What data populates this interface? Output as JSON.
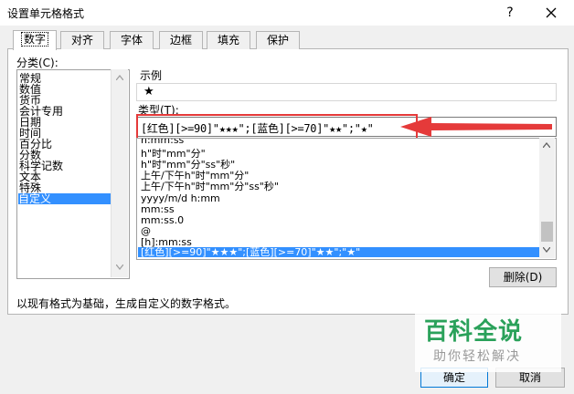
{
  "window": {
    "title": "设置单元格格式",
    "help": "?"
  },
  "tabs": [
    {
      "label": "数字",
      "active": true
    },
    {
      "label": "对齐",
      "active": false
    },
    {
      "label": "字体",
      "active": false
    },
    {
      "label": "边框",
      "active": false
    },
    {
      "label": "填充",
      "active": false
    },
    {
      "label": "保护",
      "active": false
    }
  ],
  "category": {
    "label": "分类(C):",
    "items": [
      "常规",
      "数值",
      "货币",
      "会计专用",
      "日期",
      "时间",
      "百分比",
      "分数",
      "科学记数",
      "文本",
      "特殊",
      "自定义"
    ],
    "selected": "自定义"
  },
  "sample": {
    "label": "示例",
    "value": "★"
  },
  "type": {
    "label": "类型(T):",
    "value": "[红色][>=90]\"★★★\";[蓝色][>=70]\"★★\";\"★\""
  },
  "formats": {
    "items": [
      "h:mm:ss",
      "h\"时\"mm\"分\"",
      "h\"时\"mm\"分\"ss\"秒\"",
      "上午/下午h\"时\"mm\"分\"",
      "上午/下午h\"时\"mm\"分\"ss\"秒\"",
      "yyyy/m/d h:mm",
      "mm:ss",
      "mm:ss.0",
      "@",
      "[h]:mm:ss",
      "[红色][>=90]\"★★★\";[蓝色][>=70]\"★★\";\"★\""
    ],
    "selected_index": 10
  },
  "buttons": {
    "delete": "删除(D)",
    "ok": "确定",
    "cancel": "取消"
  },
  "description": "以现有格式为基础，生成自定义的数字格式。",
  "watermark": {
    "title": "百科全说",
    "subtitle": "助你轻松解决"
  },
  "colors": {
    "selection": "#3390ff",
    "annotation_red": "#e53a3a",
    "watermark_green": "#2aa15a"
  }
}
